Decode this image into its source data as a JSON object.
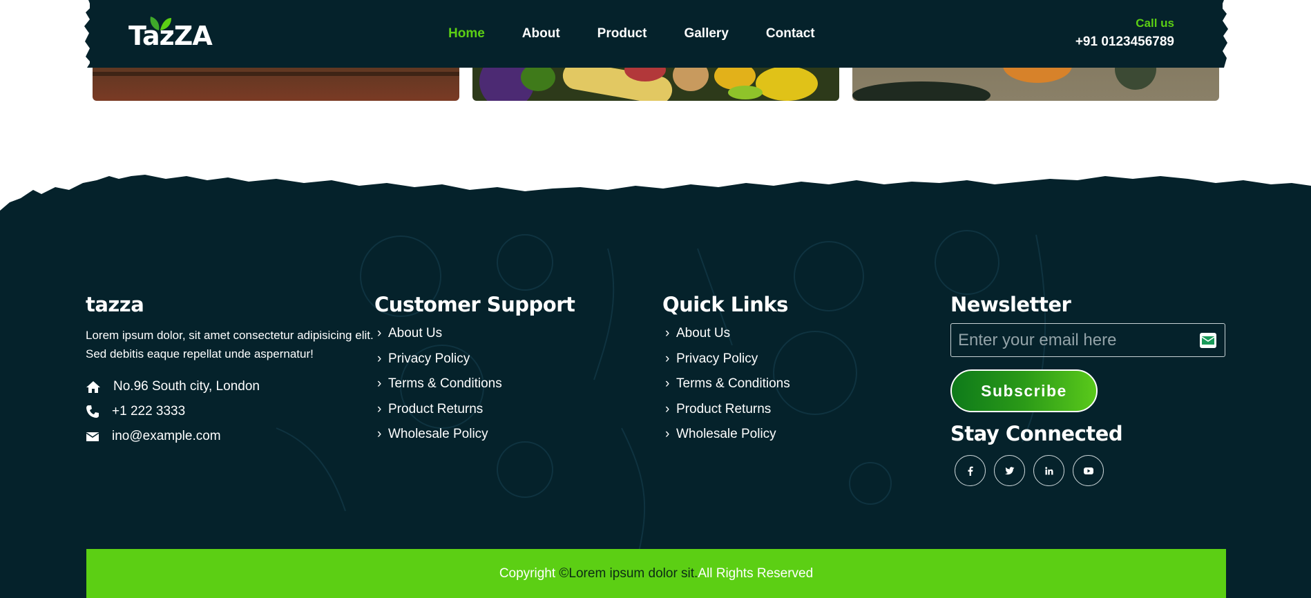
{
  "header": {
    "logo_text": "TazZA",
    "nav": [
      {
        "label": "Home",
        "active": true
      },
      {
        "label": "About",
        "active": false
      },
      {
        "label": "Product",
        "active": false
      },
      {
        "label": "Gallery",
        "active": false
      },
      {
        "label": "Contact",
        "active": false
      }
    ],
    "call_label": "Call us",
    "call_phone": "+91 0123456789"
  },
  "footer": {
    "about": {
      "title": "tazza",
      "text": "Lorem ipsum dolor, sit amet consectetur adipisicing elit. Sed debitis eaque repellat unde aspernatur!",
      "address": "No.96 South city, London",
      "phone": "+1 222 3333",
      "email": "ino@example.com"
    },
    "support": {
      "title": "Customer Support",
      "links": [
        "About Us",
        "Privacy Policy",
        "Terms & Conditions",
        "Product Returns",
        "Wholesale Policy"
      ]
    },
    "quick": {
      "title": "Quick Links",
      "links": [
        "About Us",
        "Privacy Policy",
        "Terms & Conditions",
        "Product Returns",
        "Wholesale Policy"
      ]
    },
    "newsletter": {
      "title": "Newsletter",
      "placeholder": "Enter your email here",
      "button": "Subscribe",
      "stay_title": "Stay Connected",
      "social": [
        "facebook-icon",
        "twitter-icon",
        "linkedin-icon",
        "youtube-icon"
      ]
    },
    "copyright_prefix": "Copyright ",
    "copyright_mid": "©Lorem ipsum dolor sit.",
    "copyright_suffix": "All Rights Reserved"
  },
  "colors": {
    "dark": "#05222b",
    "accent": "#5ccf14"
  }
}
